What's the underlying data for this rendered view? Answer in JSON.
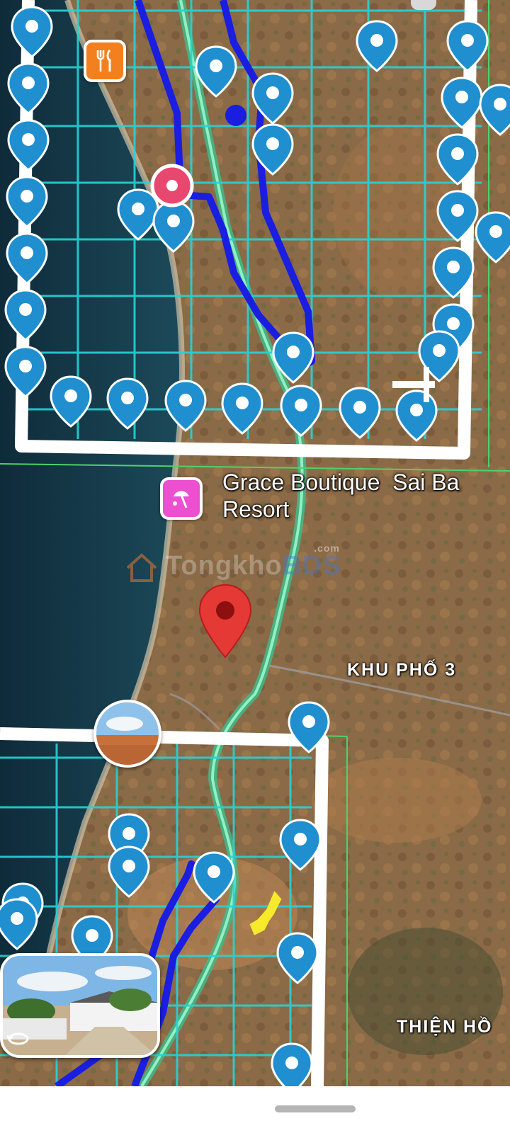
{
  "map": {
    "place_name": "Grace Boutique  Sai Ba\nResort",
    "area_labels": [
      "KHU PHỐ 3",
      "THIỆN HỒ"
    ],
    "watermark": {
      "brand_part1": "Tongkho",
      "brand_part2": "BDS",
      "tld": ".com"
    },
    "colors": {
      "sea": "#17394a",
      "land": "#8d6a48",
      "grid_lines": "#27d3d6",
      "parcel_frame": "#ffffff",
      "route": "#1a1ee0",
      "highway": "#5fcf9a",
      "pin_blue": "#1f8fd0",
      "pin_red": "#e53935",
      "restaurant_marker": "#f3801f",
      "resort_marker": "#ec4fd0",
      "highlight": "#f7ea2c"
    },
    "markers": {
      "restaurant": "restaurant-icon",
      "resort": "beach-umbrella-icon",
      "selected_location": "red-location-pin-icon",
      "listing_pins": "blue-location-pin-icon",
      "street_view": "street-view-icon"
    }
  }
}
